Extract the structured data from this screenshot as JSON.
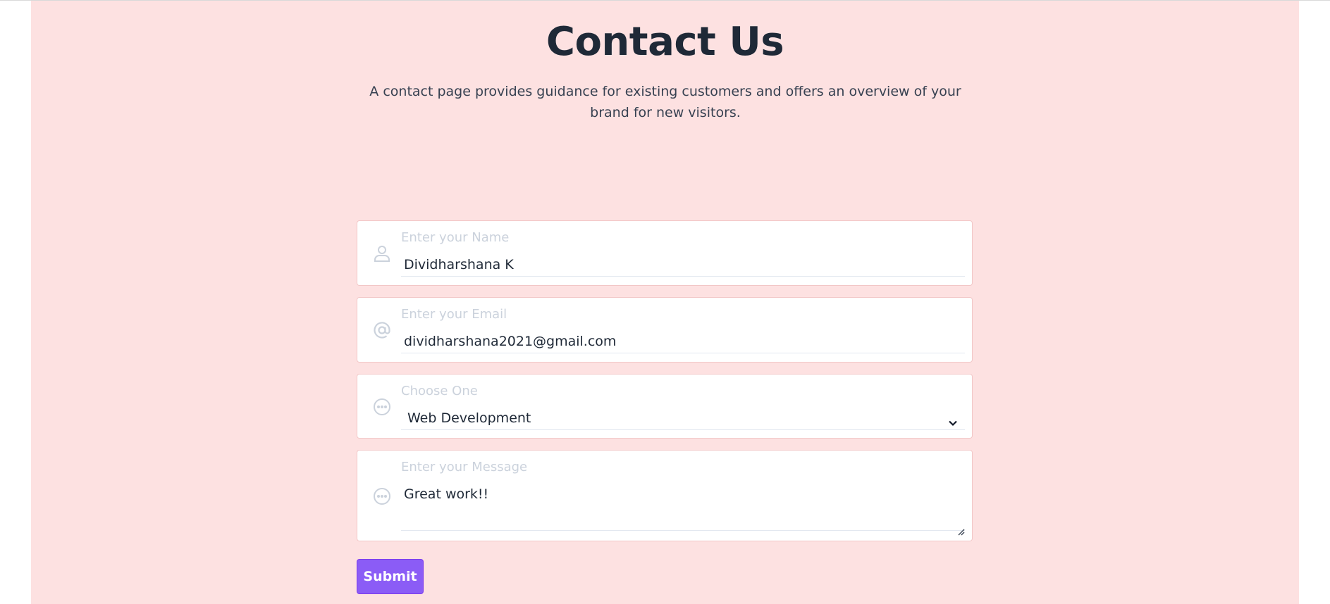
{
  "header": {
    "title": "Contact Us",
    "subtitle": "A contact page provides guidance for existing customers and offers an overview of your brand for new visitors."
  },
  "form": {
    "name": {
      "label": "Enter your Name",
      "value": "Dividharshana K",
      "icon": "user-icon"
    },
    "email": {
      "label": "Enter your Email",
      "value": "dividharshana2021@gmail.com",
      "icon": "at-sign-icon"
    },
    "service": {
      "label": "Choose One",
      "selected": "Web Development",
      "icon": "more-horizontal-circle-icon"
    },
    "message": {
      "label": "Enter your Message",
      "value": "Great work!!",
      "icon": "more-horizontal-circle-icon"
    },
    "submit_label": "Submit"
  },
  "colors": {
    "page_background": "#fde1e1",
    "accent": "#8b5cf6",
    "title_text": "#1f2937",
    "label_text": "#cbd2dc"
  }
}
